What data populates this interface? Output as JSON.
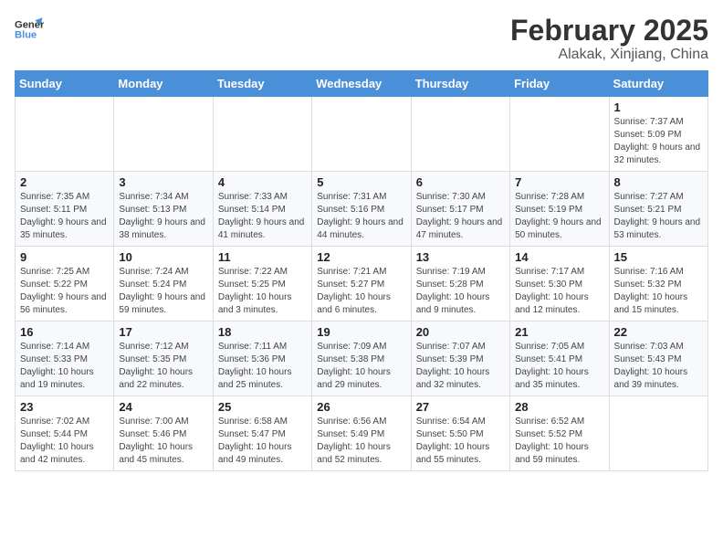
{
  "header": {
    "logo_general": "General",
    "logo_blue": "Blue",
    "title": "February 2025",
    "subtitle": "Alakak, Xinjiang, China"
  },
  "days_of_week": [
    "Sunday",
    "Monday",
    "Tuesday",
    "Wednesday",
    "Thursday",
    "Friday",
    "Saturday"
  ],
  "weeks": [
    [
      {
        "day": "",
        "info": ""
      },
      {
        "day": "",
        "info": ""
      },
      {
        "day": "",
        "info": ""
      },
      {
        "day": "",
        "info": ""
      },
      {
        "day": "",
        "info": ""
      },
      {
        "day": "",
        "info": ""
      },
      {
        "day": "1",
        "info": "Sunrise: 7:37 AM\nSunset: 5:09 PM\nDaylight: 9 hours and 32 minutes."
      }
    ],
    [
      {
        "day": "2",
        "info": "Sunrise: 7:35 AM\nSunset: 5:11 PM\nDaylight: 9 hours and 35 minutes."
      },
      {
        "day": "3",
        "info": "Sunrise: 7:34 AM\nSunset: 5:13 PM\nDaylight: 9 hours and 38 minutes."
      },
      {
        "day": "4",
        "info": "Sunrise: 7:33 AM\nSunset: 5:14 PM\nDaylight: 9 hours and 41 minutes."
      },
      {
        "day": "5",
        "info": "Sunrise: 7:31 AM\nSunset: 5:16 PM\nDaylight: 9 hours and 44 minutes."
      },
      {
        "day": "6",
        "info": "Sunrise: 7:30 AM\nSunset: 5:17 PM\nDaylight: 9 hours and 47 minutes."
      },
      {
        "day": "7",
        "info": "Sunrise: 7:28 AM\nSunset: 5:19 PM\nDaylight: 9 hours and 50 minutes."
      },
      {
        "day": "8",
        "info": "Sunrise: 7:27 AM\nSunset: 5:21 PM\nDaylight: 9 hours and 53 minutes."
      }
    ],
    [
      {
        "day": "9",
        "info": "Sunrise: 7:25 AM\nSunset: 5:22 PM\nDaylight: 9 hours and 56 minutes."
      },
      {
        "day": "10",
        "info": "Sunrise: 7:24 AM\nSunset: 5:24 PM\nDaylight: 9 hours and 59 minutes."
      },
      {
        "day": "11",
        "info": "Sunrise: 7:22 AM\nSunset: 5:25 PM\nDaylight: 10 hours and 3 minutes."
      },
      {
        "day": "12",
        "info": "Sunrise: 7:21 AM\nSunset: 5:27 PM\nDaylight: 10 hours and 6 minutes."
      },
      {
        "day": "13",
        "info": "Sunrise: 7:19 AM\nSunset: 5:28 PM\nDaylight: 10 hours and 9 minutes."
      },
      {
        "day": "14",
        "info": "Sunrise: 7:17 AM\nSunset: 5:30 PM\nDaylight: 10 hours and 12 minutes."
      },
      {
        "day": "15",
        "info": "Sunrise: 7:16 AM\nSunset: 5:32 PM\nDaylight: 10 hours and 15 minutes."
      }
    ],
    [
      {
        "day": "16",
        "info": "Sunrise: 7:14 AM\nSunset: 5:33 PM\nDaylight: 10 hours and 19 minutes."
      },
      {
        "day": "17",
        "info": "Sunrise: 7:12 AM\nSunset: 5:35 PM\nDaylight: 10 hours and 22 minutes."
      },
      {
        "day": "18",
        "info": "Sunrise: 7:11 AM\nSunset: 5:36 PM\nDaylight: 10 hours and 25 minutes."
      },
      {
        "day": "19",
        "info": "Sunrise: 7:09 AM\nSunset: 5:38 PM\nDaylight: 10 hours and 29 minutes."
      },
      {
        "day": "20",
        "info": "Sunrise: 7:07 AM\nSunset: 5:39 PM\nDaylight: 10 hours and 32 minutes."
      },
      {
        "day": "21",
        "info": "Sunrise: 7:05 AM\nSunset: 5:41 PM\nDaylight: 10 hours and 35 minutes."
      },
      {
        "day": "22",
        "info": "Sunrise: 7:03 AM\nSunset: 5:43 PM\nDaylight: 10 hours and 39 minutes."
      }
    ],
    [
      {
        "day": "23",
        "info": "Sunrise: 7:02 AM\nSunset: 5:44 PM\nDaylight: 10 hours and 42 minutes."
      },
      {
        "day": "24",
        "info": "Sunrise: 7:00 AM\nSunset: 5:46 PM\nDaylight: 10 hours and 45 minutes."
      },
      {
        "day": "25",
        "info": "Sunrise: 6:58 AM\nSunset: 5:47 PM\nDaylight: 10 hours and 49 minutes."
      },
      {
        "day": "26",
        "info": "Sunrise: 6:56 AM\nSunset: 5:49 PM\nDaylight: 10 hours and 52 minutes."
      },
      {
        "day": "27",
        "info": "Sunrise: 6:54 AM\nSunset: 5:50 PM\nDaylight: 10 hours and 55 minutes."
      },
      {
        "day": "28",
        "info": "Sunrise: 6:52 AM\nSunset: 5:52 PM\nDaylight: 10 hours and 59 minutes."
      },
      {
        "day": "",
        "info": ""
      }
    ]
  ]
}
